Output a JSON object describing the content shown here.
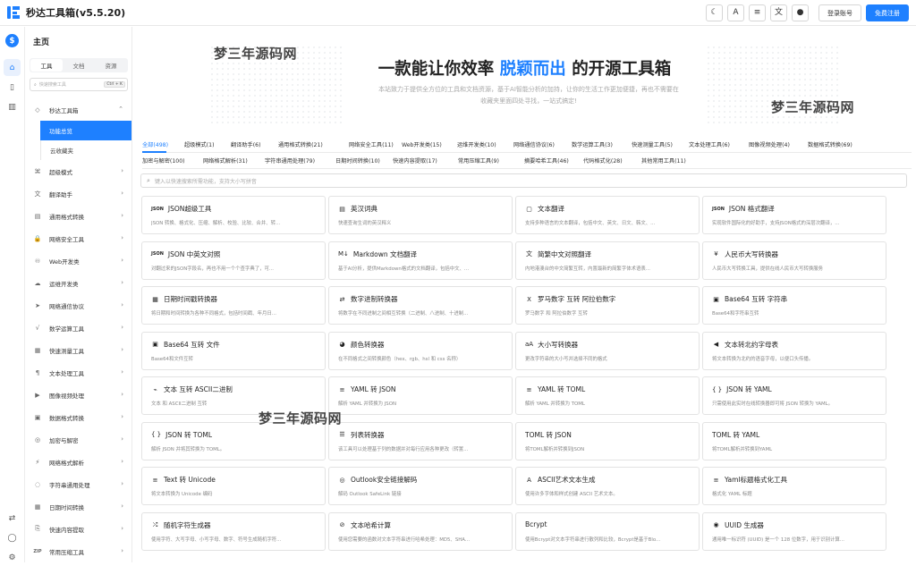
{
  "app": {
    "title": "秒达工具箱(v5.5.20)"
  },
  "topbar": {
    "icons": [
      "moon-icon",
      "font-icon",
      "text-size-icon",
      "translate-icon",
      "github-icon"
    ],
    "icon_glyphs": [
      "☾",
      "A",
      "≡",
      "文",
      "●"
    ],
    "login": "登录账号",
    "register": "免费注册"
  },
  "rail": {
    "avatar": "$",
    "icons": [
      "home-icon",
      "book-icon",
      "store-icon"
    ],
    "bottom_icons": [
      "swap-icon",
      "user-icon",
      "settings-icon"
    ]
  },
  "sidebar": {
    "heading": "主页",
    "tabs": [
      "工具",
      "文档",
      "资源"
    ],
    "search_placeholder": "快速搜索工具",
    "search_shortcut": "Ctrl + K",
    "group": {
      "label": "秒达工具箱",
      "icon": "◇"
    },
    "subitems": [
      "功能总览",
      "云收藏夹"
    ],
    "items": [
      {
        "label": "超级模式",
        "icon": "⌘"
      },
      {
        "label": "翻译助手",
        "icon": "文"
      },
      {
        "label": "通用格式转换",
        "icon": "▤"
      },
      {
        "label": "网络安全工具",
        "icon": "🔒"
      },
      {
        "label": "Web开发类",
        "icon": "♾"
      },
      {
        "label": "运维开发类",
        "icon": "☁"
      },
      {
        "label": "网络通信协议",
        "icon": "➤"
      },
      {
        "label": "数学运算工具",
        "icon": "√"
      },
      {
        "label": "快速测量工具",
        "icon": "▦"
      },
      {
        "label": "文本处理工具",
        "icon": "¶"
      },
      {
        "label": "图像视频处理",
        "icon": "▶"
      },
      {
        "label": "数据格式转换",
        "icon": "▣"
      },
      {
        "label": "加密与解密",
        "icon": "◎"
      },
      {
        "label": "网络格式解析",
        "icon": "⚡"
      },
      {
        "label": "字符串通用处理",
        "icon": "◌"
      },
      {
        "label": "日期时间转换",
        "icon": "▦"
      },
      {
        "label": "快速内容提取",
        "icon": "⎘"
      },
      {
        "label": "常用压缩工具",
        "icon": "ZIP"
      }
    ]
  },
  "hero": {
    "title_pre": "一款能让你效率 ",
    "title_highlight": "脱颖而出",
    "title_post": " 的开源工具箱",
    "subtitle": "本站致力于提供全方位的工具和文档资源，基于AI智能分析的加持，让你的生活工作更加便捷，再也不需要在收藏夹里面四处寻找，一站式搞定!",
    "watermark": "梦三年源码网"
  },
  "categories": {
    "row1": [
      "全部(498)",
      "超级模式(1)",
      "翻译助手(6)",
      "通用格式转换(21)",
      "网络安全工具(11)",
      "Web开发类(15)",
      "运维开发类(10)",
      "网络通信协议(6)",
      "数学运算工具(3)",
      "快速测量工具(5)",
      "文本处理工具(6)",
      "图像视频处理(4)",
      "数据格式转换(69)"
    ],
    "row2": [
      "加密与解密(100)",
      "网络格式解析(31)",
      "字符串通用处理(79)",
      "日期时间转换(10)",
      "快速内容提取(17)",
      "常用压缩工具(9)",
      "摘要哈希工具(46)",
      "代码格式化(28)",
      "其他常用工具(11)"
    ]
  },
  "main_search": {
    "placeholder": "键入以快速搜索所需功能，支持大小写拼音"
  },
  "tools": [
    {
      "icon": "JSON",
      "name": "JSON超级工具",
      "desc": "JSON 转换、格式化、压缩、解析、校验、比较、合并、转..."
    },
    {
      "icon": "▤",
      "name": "英汉词典",
      "desc": "快速查询生词的英汉释义"
    },
    {
      "icon": "▢",
      "name": "文本翻译",
      "desc": "支持多种语言的文本翻译，包括中文、英文、日文、韩文、..."
    },
    {
      "icon": "JSON",
      "name": "JSON 格式翻译",
      "desc": "实现软件国际化的好助手，支持JSON格式的深层次翻译，..."
    },
    {
      "icon": "JSON",
      "name": "JSON 中英文对照",
      "desc": "对翻过来的JSON字段名，再也不用一个个查字典了，可..."
    },
    {
      "icon": "M↓",
      "name": "Markdown 文档翻译",
      "desc": "基于AI分析，提供Markdown格式的文档翻译，包括中文、..."
    },
    {
      "icon": "文",
      "name": "简繁中文对照翻译",
      "desc": "内地港澳台的中文简繁互转，内置最新的简繁字体术语表..."
    },
    {
      "icon": "¥",
      "name": "人民币大写转换器",
      "desc": "人民币大写转换工具，提供在线人民币大写转换服务"
    },
    {
      "icon": "▦",
      "name": "日期时间戳转换器",
      "desc": "将日期和时间转换为各种不同格式，包括时间戳、年月日..."
    },
    {
      "icon": "⇄",
      "name": "数字进制转换器",
      "desc": "将数字在不同进制之间相互转换（二进制、八进制、十进制..."
    },
    {
      "icon": "X",
      "name": "罗马数字 互转 阿拉伯数字",
      "desc": "罗马数字 和 阿拉伯数字 互转"
    },
    {
      "icon": "▣",
      "name": "Base64 互转 字符串",
      "desc": "Base64和字符串互转"
    },
    {
      "icon": "▣",
      "name": "Base64 互转 文件",
      "desc": "Base64和文件互转"
    },
    {
      "icon": "◕",
      "name": "颜色转换器",
      "desc": "在不同格式之间转换颜色（hex、rgb、hsl 和 css 名称）"
    },
    {
      "icon": "aA",
      "name": "大小写转换器",
      "desc": "更改字符串的大小写并选择不同的格式"
    },
    {
      "icon": "◀",
      "name": "文本转北约字母表",
      "desc": "将文本转换为北约的语音字母，以便口头传播。"
    },
    {
      "icon": "⌁",
      "name": "文本 互转 ASCII二进制",
      "desc": "文本 和 ASCII二进制 互转"
    },
    {
      "icon": "≡",
      "name": "YAML 转 JSON",
      "desc": "解析 YAML 并转换为 JSON"
    },
    {
      "icon": "≡",
      "name": "YAML 转 TOML",
      "desc": "解析 YAML 并转换为 TOML"
    },
    {
      "icon": "{ }",
      "name": "JSON 转 YAML",
      "desc": "只需使用此实时在线转换器即可将 JSON 转换为 YAML。"
    },
    {
      "icon": "{ }",
      "name": "JSON 转 TOML",
      "desc": "解析 JSON 并将其转换为 TOML。"
    },
    {
      "icon": "☰",
      "name": "列表转换器",
      "desc": "该工具可以处理基于列的数据并对每行应用各种更改（转置..."
    },
    {
      "icon": "",
      "name": "TOML 转 JSON",
      "desc": "将TOML解析并转换到JSON"
    },
    {
      "icon": "",
      "name": "TOML 转 YAML",
      "desc": "将TOML解析并转换到YAML"
    },
    {
      "icon": "≡",
      "name": "Text 转 Unicode",
      "desc": "将文本转换为 Unicode 编码"
    },
    {
      "icon": "◎",
      "name": "Outlook安全链接解码",
      "desc": "解码 Outlook SafeLink 链接"
    },
    {
      "icon": "A",
      "name": "ASCII艺术文本生成",
      "desc": "使用许多字体和样式创建 ASCII 艺术文本。"
    },
    {
      "icon": "≡",
      "name": "Yaml标题格式化工具",
      "desc": "格式化 YAML 标题"
    },
    {
      "icon": "⤮",
      "name": "随机字符生成器",
      "desc": "使用字符、大写字母、小写字母、数字、符号生成随机字符..."
    },
    {
      "icon": "⊘",
      "name": "文本哈希计算",
      "desc": "使用您需要的函数对文本字符串进行哈希处理：MD5、SHA..."
    },
    {
      "icon": "",
      "name": "Bcrypt",
      "desc": "使用Bcrypt对文本字符串进行散列和比较，Bcrypt是基于Blo..."
    },
    {
      "icon": "◉",
      "name": "UUID 生成器",
      "desc": "通用唯一标识符 (UUID) 是一个 128 位数字，用于识别计算..."
    }
  ]
}
